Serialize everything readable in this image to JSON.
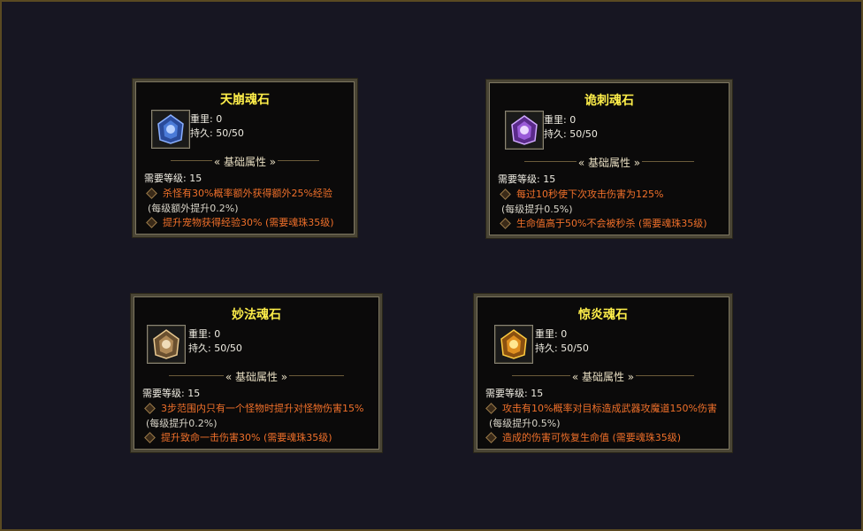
{
  "common": {
    "weight_label": "重里: 0",
    "durability_label": "持久: 50/50",
    "section_label": "« 基础属性 »",
    "req_level": "需要等级: 15"
  },
  "cards": [
    {
      "title": "天崩魂石",
      "icon": "blue-soul-stone-icon",
      "attr1": "杀怪有30%概率额外获得额外25%经验",
      "note": "(每级额外提升0.2%)",
      "attr2": "提升宠物获得经验30% (需要魂珠35级)"
    },
    {
      "title": "诡刺魂石",
      "icon": "purple-soul-stone-icon",
      "attr1": "每过10秒使下次攻击伤害为125%",
      "note": "(每级提升0.5%)",
      "attr2": "生命值高于50%不会被秒杀 (需要魂珠35级)"
    },
    {
      "title": "妙法魂石",
      "icon": "tan-soul-stone-icon",
      "attr1": "3步范围内只有一个怪物时提升对怪物伤害15%",
      "note": "(每级提升0.2%)",
      "attr2": "提升致命一击伤害30% (需要魂珠35级)"
    },
    {
      "title": "惊炎魂石",
      "icon": "gold-soul-stone-icon",
      "attr1": "攻击有10%概率对目标造成武器攻魔道150%伤害",
      "note": "(每级提升0.5%)",
      "attr2": "造成的伤害可恢复生命值 (需要魂珠35级)"
    }
  ]
}
